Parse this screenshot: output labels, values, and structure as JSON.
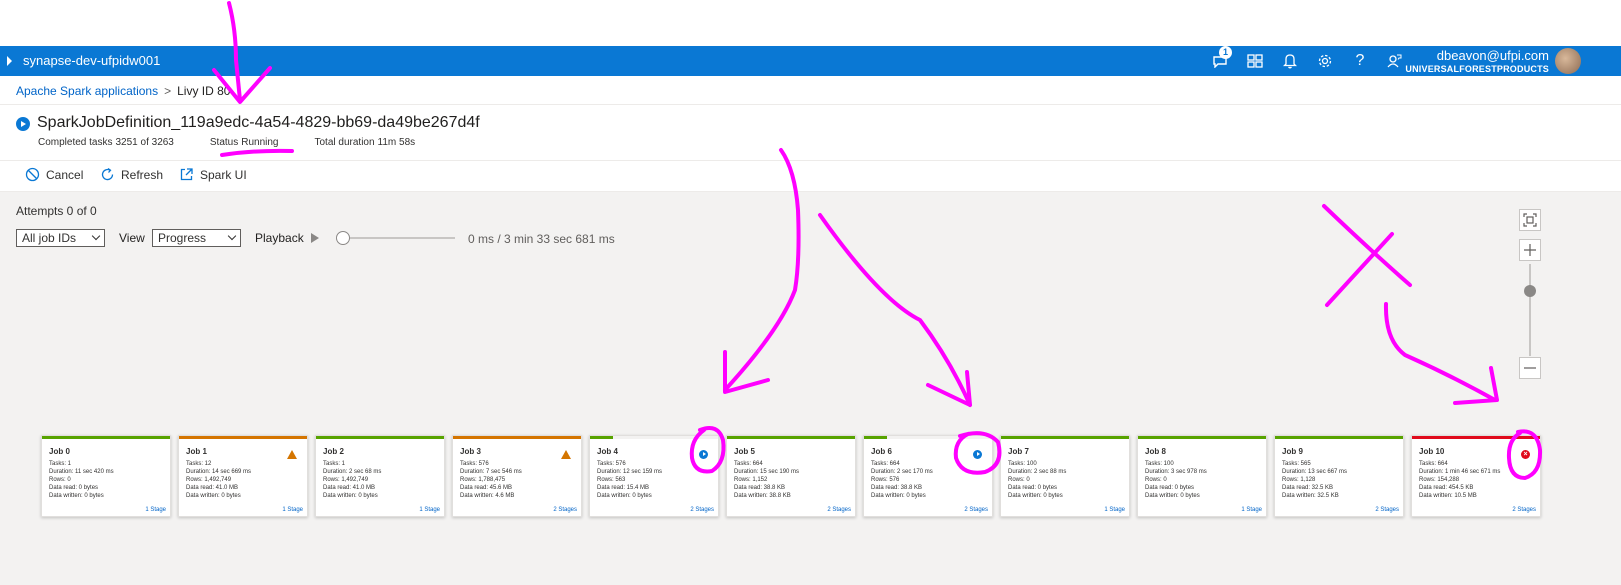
{
  "header": {
    "workspace": "synapse-dev-ufpidw001",
    "notification_count": "1",
    "user_email": "dbeavon@ufpi.com",
    "user_org": "UNIVERSALFORESTPRODUCTS"
  },
  "breadcrumb": {
    "parent": "Apache Spark applications",
    "separator": ">",
    "current": "Livy ID 80"
  },
  "title": {
    "name": "SparkJobDefinition_119a9edc-4a54-4829-bb69-da49be267d4f",
    "completed_label": "Completed tasks",
    "completed_value": "3251 of 3263",
    "status_label": "Status",
    "status_value": "Running",
    "duration_label": "Total duration",
    "duration_value": "11m 58s"
  },
  "toolbar": {
    "cancel": "Cancel",
    "refresh": "Refresh",
    "spark_ui": "Spark UI"
  },
  "controls": {
    "attempts": "Attempts 0 of 0",
    "job_filter": "All job IDs",
    "view_label": "View",
    "view_value": "Progress",
    "playback_label": "Playback",
    "playback_time": "0 ms / 3 min 33 sec 681 ms"
  },
  "colors": {
    "accent": "#0a78d4",
    "succeeded": "#57a300",
    "warning": "#d47500",
    "failed": "#e00b1c",
    "annotation": "#ff00ff"
  },
  "jobs": [
    {
      "name": "Job 0",
      "tasks": "Tasks: 1",
      "duration": "Duration: 11 sec 420 ms",
      "rows": "Rows: 0",
      "read": "Data read: 0 bytes",
      "written": "Data written: 0 bytes",
      "stages": "1 Stage",
      "status": "succeeded"
    },
    {
      "name": "Job 1",
      "tasks": "Tasks: 12",
      "duration": "Duration: 14 sec 669 ms",
      "rows": "Rows: 1,492,749",
      "read": "Data read: 41.0 MB",
      "written": "Data written: 0 bytes",
      "stages": "1 Stage",
      "status": "warning"
    },
    {
      "name": "Job 2",
      "tasks": "Tasks: 1",
      "duration": "Duration: 2 sec 68 ms",
      "rows": "Rows: 1,492,749",
      "read": "Data read: 41.0 MB",
      "written": "Data written: 0 bytes",
      "stages": "1 Stage",
      "status": "succeeded"
    },
    {
      "name": "Job 3",
      "tasks": "Tasks: 576",
      "duration": "Duration: 7 sec 546 ms",
      "rows": "Rows: 1,788,475",
      "read": "Data read: 45.6 MB",
      "written": "Data written: 4.6 MB",
      "stages": "2 Stages",
      "status": "warning"
    },
    {
      "name": "Job 4",
      "tasks": "Tasks: 576",
      "duration": "Duration: 12 sec 159 ms",
      "rows": "Rows: 563",
      "read": "Data read: 15.4 MB",
      "written": "Data written: 0 bytes",
      "stages": "2 Stages",
      "status": "running"
    },
    {
      "name": "Job 5",
      "tasks": "Tasks: 664",
      "duration": "Duration: 15 sec 190 ms",
      "rows": "Rows: 1,152",
      "read": "Data read: 38.8 KB",
      "written": "Data written: 38.8 KB",
      "stages": "2 Stages",
      "status": "succeeded"
    },
    {
      "name": "Job 6",
      "tasks": "Tasks: 664",
      "duration": "Duration: 2 sec 170 ms",
      "rows": "Rows: 576",
      "read": "Data read: 38.8 KB",
      "written": "Data written: 0 bytes",
      "stages": "2 Stages",
      "status": "running"
    },
    {
      "name": "Job 7",
      "tasks": "Tasks: 100",
      "duration": "Duration: 2 sec 88 ms",
      "rows": "Rows: 0",
      "read": "Data read: 0 bytes",
      "written": "Data written: 0 bytes",
      "stages": "1 Stage",
      "status": "succeeded"
    },
    {
      "name": "Job 8",
      "tasks": "Tasks: 100",
      "duration": "Duration: 3 sec 978 ms",
      "rows": "Rows: 0",
      "read": "Data read: 0 bytes",
      "written": "Data written: 0 bytes",
      "stages": "1 Stage",
      "status": "succeeded"
    },
    {
      "name": "Job 9",
      "tasks": "Tasks: 565",
      "duration": "Duration: 13 sec 667 ms",
      "rows": "Rows: 1,128",
      "read": "Data read: 32.5 KB",
      "written": "Data written: 32.5 KB",
      "stages": "2 Stages",
      "status": "succeeded"
    },
    {
      "name": "Job 10",
      "tasks": "Tasks: 664",
      "duration": "Duration: 1 min 46 sec 671 ms",
      "rows": "Rows: 154,288",
      "read": "Data read: 454.5 KB",
      "written": "Data written: 10.5 MB",
      "stages": "2 Stages",
      "status": "failed"
    }
  ]
}
